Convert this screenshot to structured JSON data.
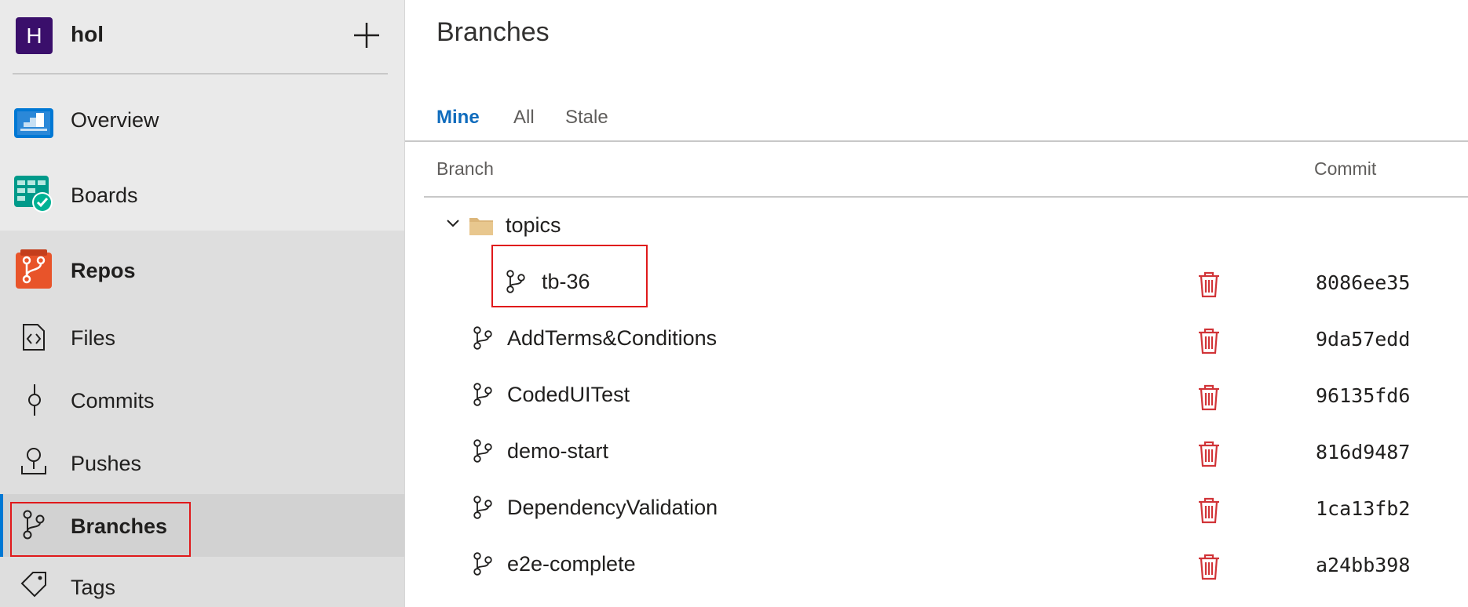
{
  "project": {
    "initial": "H",
    "name": "hol"
  },
  "nav": {
    "overview": "Overview",
    "boards": "Boards",
    "repos": "Repos",
    "files": "Files",
    "commits": "Commits",
    "pushes": "Pushes",
    "branches": "Branches",
    "tags": "Tags"
  },
  "main": {
    "title": "Branches",
    "tabs": [
      "Mine",
      "All",
      "Stale"
    ],
    "active_tab": "Mine",
    "columns": {
      "branch": "Branch",
      "commit": "Commit"
    },
    "folder": {
      "name": "topics",
      "expanded": true
    },
    "branches": [
      {
        "name": "tb-36",
        "commit": "8086ee35",
        "in_folder": true
      },
      {
        "name": "AddTerms&Conditions",
        "commit": "9da57edd",
        "in_folder": false
      },
      {
        "name": "CodedUITest",
        "commit": "96135fd6",
        "in_folder": false
      },
      {
        "name": "demo-start",
        "commit": "816d9487",
        "in_folder": false
      },
      {
        "name": "DependencyValidation",
        "commit": "1ca13fb2",
        "in_folder": false
      },
      {
        "name": "e2e-complete",
        "commit": "a24bb398",
        "in_folder": false
      }
    ]
  },
  "colors": {
    "accent": "#0f6cbd",
    "avatar": "#3a0f6b",
    "delete": "#d13438",
    "highlight": "#e0191b",
    "folder": "#dcb67a",
    "repos_icon": "#e8542a"
  },
  "icons": {
    "add": "plus-icon",
    "overview": "overview-icon",
    "boards": "boards-icon",
    "repos": "repos-icon",
    "files": "file-code-icon",
    "commits": "commit-icon",
    "pushes": "push-icon",
    "branches": "branch-icon",
    "tags": "tag-icon",
    "delete": "trash-icon",
    "folder": "folder-icon",
    "expand": "chevron-down-icon"
  }
}
